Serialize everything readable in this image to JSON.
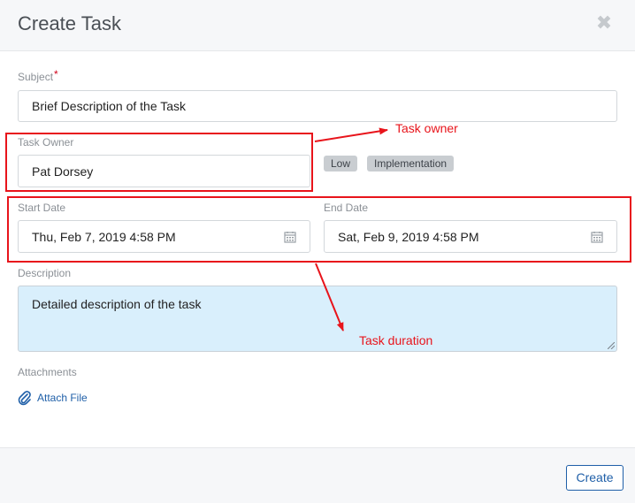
{
  "dialog": {
    "title": "Create Task",
    "close_icon": "close-icon"
  },
  "subject": {
    "label": "Subject",
    "required_mark": "*",
    "value": "Brief Description of the Task"
  },
  "task_owner": {
    "label": "Task Owner",
    "value": "Pat Dorsey",
    "badges": [
      "Low",
      "Implementation"
    ]
  },
  "start_date": {
    "label": "Start Date",
    "value": "Thu, Feb 7, 2019 4:58 PM",
    "icon": "calendar-icon"
  },
  "end_date": {
    "label": "End Date",
    "value": "Sat, Feb 9, 2019 4:58 PM",
    "icon": "calendar-icon"
  },
  "description": {
    "label": "Description",
    "value": "Detailed description of the task"
  },
  "attachments": {
    "label": "Attachments",
    "link": "Attach File",
    "icon": "paperclip-icon"
  },
  "footer": {
    "create_label": "Create"
  },
  "annotations": {
    "owner_note": "Task owner",
    "duration_note": "Task duration",
    "color": "#e8141b"
  },
  "colors": {
    "accent": "#1f5fa8",
    "description_bg": "#d9effc",
    "badge_bg": "#c9cdd1"
  }
}
